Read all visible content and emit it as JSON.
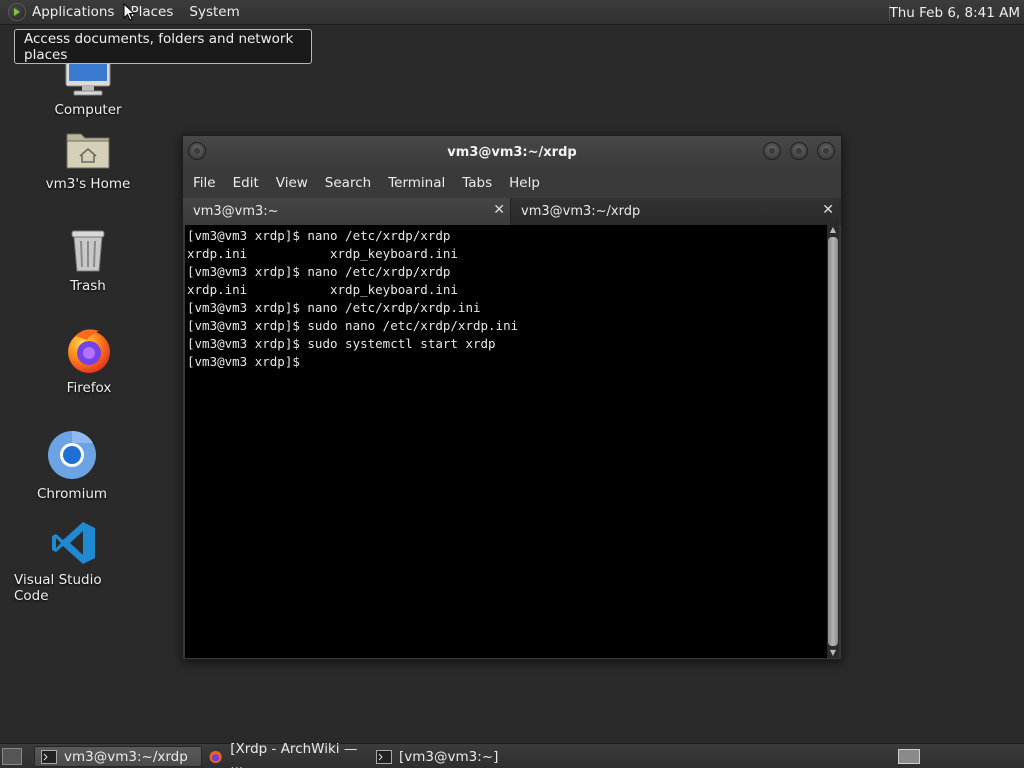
{
  "top_panel": {
    "menus": [
      "Applications",
      "Places",
      "System"
    ],
    "clock": "Thu Feb  6,  8:41 AM"
  },
  "tooltip": "Access documents, folders and network places",
  "desktop_icons": [
    {
      "label": "Computer",
      "icon": "computer-icon"
    },
    {
      "label": "vm3's Home",
      "icon": "home-folder-icon"
    },
    {
      "label": "Trash",
      "icon": "trash-icon"
    },
    {
      "label": "Firefox",
      "icon": "firefox-icon"
    },
    {
      "label": "Chromium",
      "icon": "chromium-icon"
    },
    {
      "label": "Visual Studio Code",
      "icon": "vscode-icon"
    }
  ],
  "terminal": {
    "title": "vm3@vm3:~/xrdp",
    "menu": [
      "File",
      "Edit",
      "View",
      "Search",
      "Terminal",
      "Tabs",
      "Help"
    ],
    "tabs": [
      {
        "label": "vm3@vm3:~",
        "active": false
      },
      {
        "label": "vm3@vm3:~/xrdp",
        "active": true
      }
    ],
    "lines": [
      "[vm3@vm3 xrdp]$ nano /etc/xrdp/xrdp",
      "xrdp.ini           xrdp_keyboard.ini",
      "[vm3@vm3 xrdp]$ nano /etc/xrdp/xrdp",
      "xrdp.ini           xrdp_keyboard.ini",
      "[vm3@vm3 xrdp]$ nano /etc/xrdp/xrdp.ini",
      "[vm3@vm3 xrdp]$ sudo nano /etc/xrdp/xrdp.ini",
      "[vm3@vm3 xrdp]$ sudo systemctl start xrdp",
      "[vm3@vm3 xrdp]$ "
    ]
  },
  "taskbar": {
    "tasks": [
      {
        "label": "vm3@vm3:~/xrdp",
        "icon": "terminal-icon",
        "active": true
      },
      {
        "label": "[Xrdp - ArchWiki — ...",
        "icon": "firefox-icon",
        "active": false
      },
      {
        "label": "[vm3@vm3:~]",
        "icon": "terminal-icon",
        "active": false
      }
    ]
  },
  "colors": {
    "desktop_bg": "#2a2a2a",
    "panel_bg": "#363636",
    "terminal_bg": "#000000",
    "terminal_fg": "#e8e8e8"
  }
}
